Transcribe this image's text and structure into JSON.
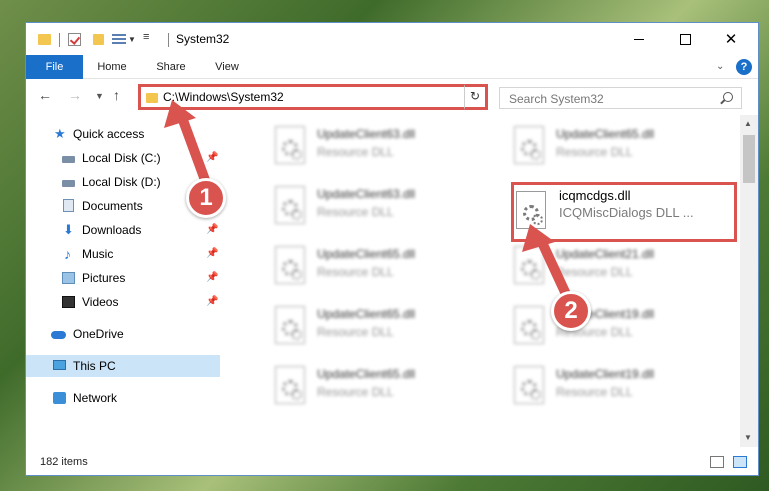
{
  "window": {
    "title": "System32"
  },
  "ribbon": {
    "tabs": [
      {
        "label": "File"
      },
      {
        "label": "Home"
      },
      {
        "label": "Share"
      },
      {
        "label": "View"
      }
    ],
    "help_label": "?"
  },
  "navbar": {
    "address": "C:\\Windows\\System32",
    "search_placeholder": "Search System32"
  },
  "sidebar": {
    "items": [
      {
        "label": "Quick access",
        "icon": "star-icon"
      },
      {
        "label": "Local Disk (C:)",
        "icon": "drive-icon",
        "pinned": true
      },
      {
        "label": "Local Disk (D:)",
        "icon": "drive-icon"
      },
      {
        "label": "Documents",
        "icon": "documents-icon",
        "pinned": true
      },
      {
        "label": "Downloads",
        "icon": "download-icon",
        "pinned": true
      },
      {
        "label": "Music",
        "icon": "music-icon",
        "pinned": true
      },
      {
        "label": "Pictures",
        "icon": "pictures-icon",
        "pinned": true
      },
      {
        "label": "Videos",
        "icon": "video-icon",
        "pinned": true
      },
      {
        "label": "OneDrive",
        "icon": "cloud-icon"
      },
      {
        "label": "This PC",
        "icon": "computer-icon",
        "selected": true
      },
      {
        "label": "Network",
        "icon": "network-icon"
      }
    ]
  },
  "files": {
    "left_column": [
      {
        "name": "UpdateClient63.dll",
        "type": "Resource DLL"
      },
      {
        "name": "UpdateClient63.dll",
        "type": "Resource DLL"
      },
      {
        "name": "UpdateClient65.dll",
        "type": "Resource DLL"
      },
      {
        "name": "UpdateClient65.dll",
        "type": "Resource DLL"
      },
      {
        "name": "UpdateClient65.dll",
        "type": "Resource DLL"
      }
    ],
    "right_column": [
      {
        "name": "UpdateClient65.dll",
        "type": "Resource DLL"
      },
      {
        "name": "icqmcdgs.dll",
        "type": "ICQMiscDialogs DLL ...",
        "highlighted": true
      },
      {
        "name": "UpdateClient21.dll",
        "type": "Resource DLL"
      },
      {
        "name": "UpdateClient19.dll",
        "type": "Resource DLL"
      },
      {
        "name": "UpdateClient19.dll",
        "type": "Resource DLL"
      }
    ]
  },
  "status": {
    "item_count": "182 items"
  },
  "annotations": [
    {
      "number": "1"
    },
    {
      "number": "2"
    }
  ],
  "colors": {
    "accent": "#1a6fc9",
    "highlight": "#d9534f",
    "selection": "#cce4f7"
  }
}
